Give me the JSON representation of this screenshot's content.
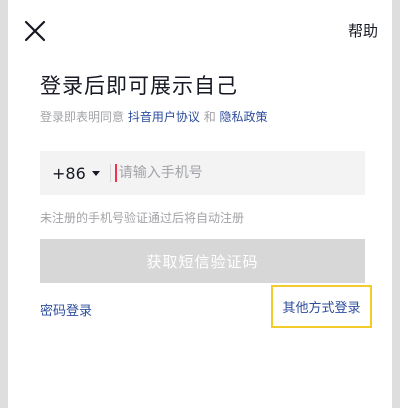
{
  "header": {
    "close_icon": "close-icon",
    "help_label": "帮助"
  },
  "main": {
    "title": "登录后即可展示自己",
    "agreement": {
      "prefix": "登录即表明同意",
      "user_agreement": "抖音用户协议",
      "conjunction": "和",
      "privacy_policy": "隐私政策"
    },
    "phone": {
      "country_code": "+86",
      "placeholder": "请输入手机号",
      "value": ""
    },
    "hint": "未注册的手机号验证通过后将自动注册",
    "sms_button_label": "获取短信验证码",
    "password_login_label": "密码登录",
    "other_login_label": "其他方式登录"
  },
  "colors": {
    "link": "#2d4d9c",
    "muted_text": "#a2a3a7",
    "disabled_button": "#d7d7d8",
    "cursor": "#f5314b",
    "highlight_border": "#f2cc2b"
  }
}
